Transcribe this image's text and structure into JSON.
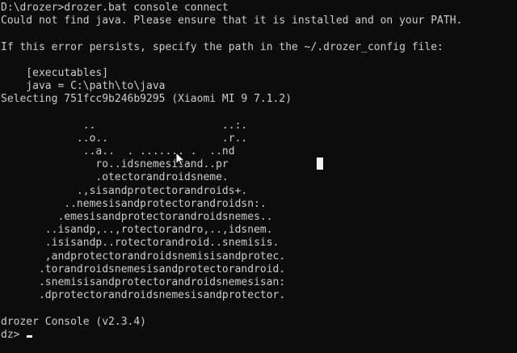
{
  "console": {
    "lines": [
      "D:\\drozer>drozer.bat console connect",
      "Could not find java. Please ensure that it is installed and on your PATH.",
      "",
      "If this error persists, specify the path in the ~/.drozer_config file:",
      "",
      "    [executables]",
      "    java = C:\\path\\to\\java",
      "Selecting 751fcc9b246b9295 (Xiaomi MI 9 7.1.2)",
      "",
      "             ..                    ..:.",
      "            ..o..                  .r..",
      "             ..a..  . ....... .  ..nd",
      "               ro..idsnemesisand..pr",
      "               .otectorandroidsneme.",
      "            .,sisandprotectorandroids+.",
      "          ..nemesisandprotectorandroidsn:.",
      "         .emesisandprotectorandroidsnemes..",
      "       ..isandp,..,rotectorandro,..,idsnem.",
      "       .isisandp..rotectorandroid..snemisis.",
      "       ,andprotectorandroidsnemisisandprotec.",
      "      .torandroidsnemesisandprotectorandroid.",
      "      .snemisisandprotectorandroidsnemesisan:",
      "      .dprotectorandroidsnemesisandprotector.",
      "",
      "drozer Console (v2.3.4)"
    ],
    "prompt": "dz> "
  },
  "icons": {
    "mouse_pointer": "arrow-cursor-icon",
    "text_cursor": "block-cursor"
  },
  "colors": {
    "background": "#0c0c0c",
    "foreground": "#cccccc",
    "cursor": "#f2f2f2"
  }
}
